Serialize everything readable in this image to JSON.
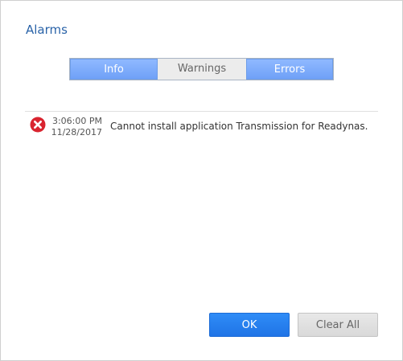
{
  "dialog": {
    "title": "Alarms"
  },
  "tabs": [
    {
      "label": "Info",
      "state": "active"
    },
    {
      "label": "Warnings",
      "state": "inactive"
    },
    {
      "label": "Errors",
      "state": "active"
    }
  ],
  "alarms": [
    {
      "severity": "error",
      "icon": "error-x-icon",
      "time": "3:06:00 PM",
      "date": "11/28/2017",
      "message": "Cannot install application Transmission for Readynas."
    }
  ],
  "buttons": {
    "ok_label": "OK",
    "clear_label": "Clear All"
  },
  "colors": {
    "accent": "#2f8cf7",
    "tab_active": "#7aa9fb",
    "error": "#d9242f",
    "title": "#2a63a8"
  }
}
